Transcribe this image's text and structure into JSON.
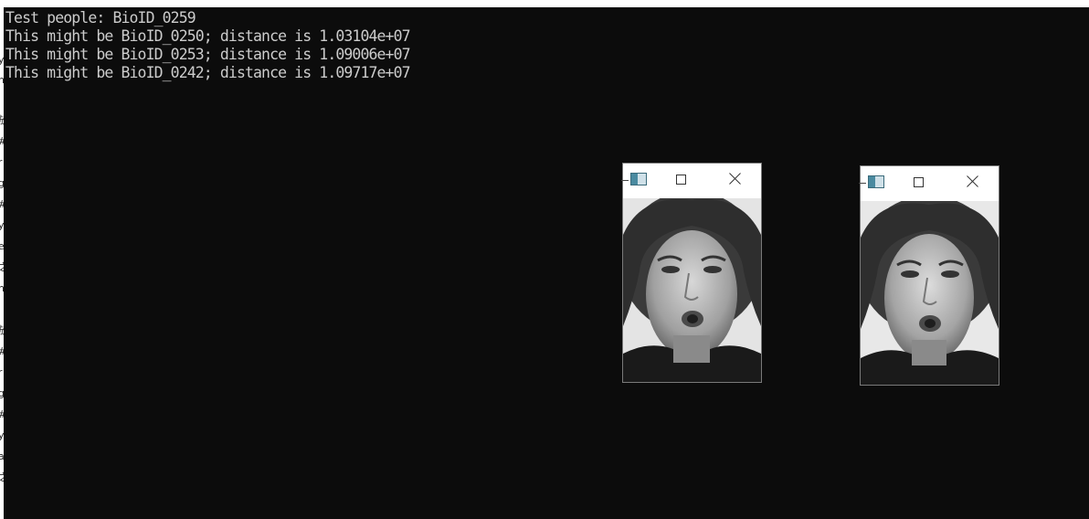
{
  "console": {
    "lines": [
      "Test people: BioID_0259",
      "This might be BioID_0250; distance is 1.03104e+07",
      "This might be BioID_0253; distance is 1.09006e+07",
      "This might be BioID_0242; distance is 1.09717e+07"
    ],
    "text_color": "#cccccc",
    "background_color": "#0c0c0c"
  },
  "left_gutter": {
    "chars": [
      "y",
      "n",
      "放",
      "#",
      "r",
      "g",
      "#",
      "y",
      "e",
      "之",
      "n",
      "放",
      "#",
      "r",
      "g",
      "#",
      "y",
      "a",
      "之"
    ]
  },
  "image_windows": [
    {
      "icons": {
        "app": "opencv-window-icon",
        "maximize": "maximize-icon",
        "close": "close-icon"
      },
      "image": "grayscale-face-photo"
    },
    {
      "icons": {
        "app": "opencv-window-icon",
        "maximize": "maximize-icon",
        "close": "close-icon"
      },
      "image": "grayscale-face-photo"
    }
  ]
}
